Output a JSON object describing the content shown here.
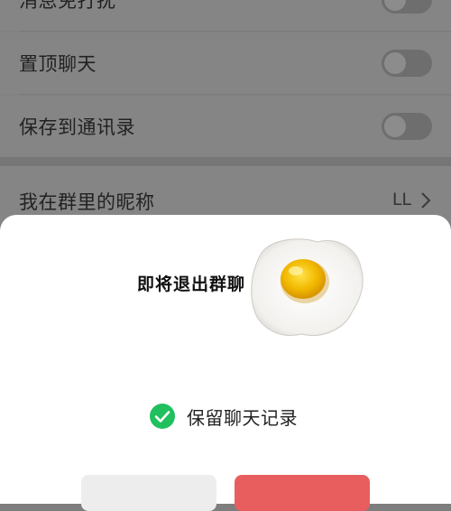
{
  "settings": {
    "rows": [
      {
        "label": "消息免打扰"
      },
      {
        "label": "置顶聊天"
      },
      {
        "label": "保存到通讯录"
      }
    ],
    "nickname_row": {
      "label": "我在群里的昵称",
      "value": "LL"
    }
  },
  "dialog": {
    "title": "即将退出群聊",
    "keep_history_label": "保留聊天记录",
    "keep_history_checked": true
  },
  "colors": {
    "accent_green": "#20c05f",
    "confirm_red": "#e85e5e"
  },
  "icons": [
    "check-circle-icon",
    "chevron-right-icon",
    "fried-egg-icon"
  ]
}
